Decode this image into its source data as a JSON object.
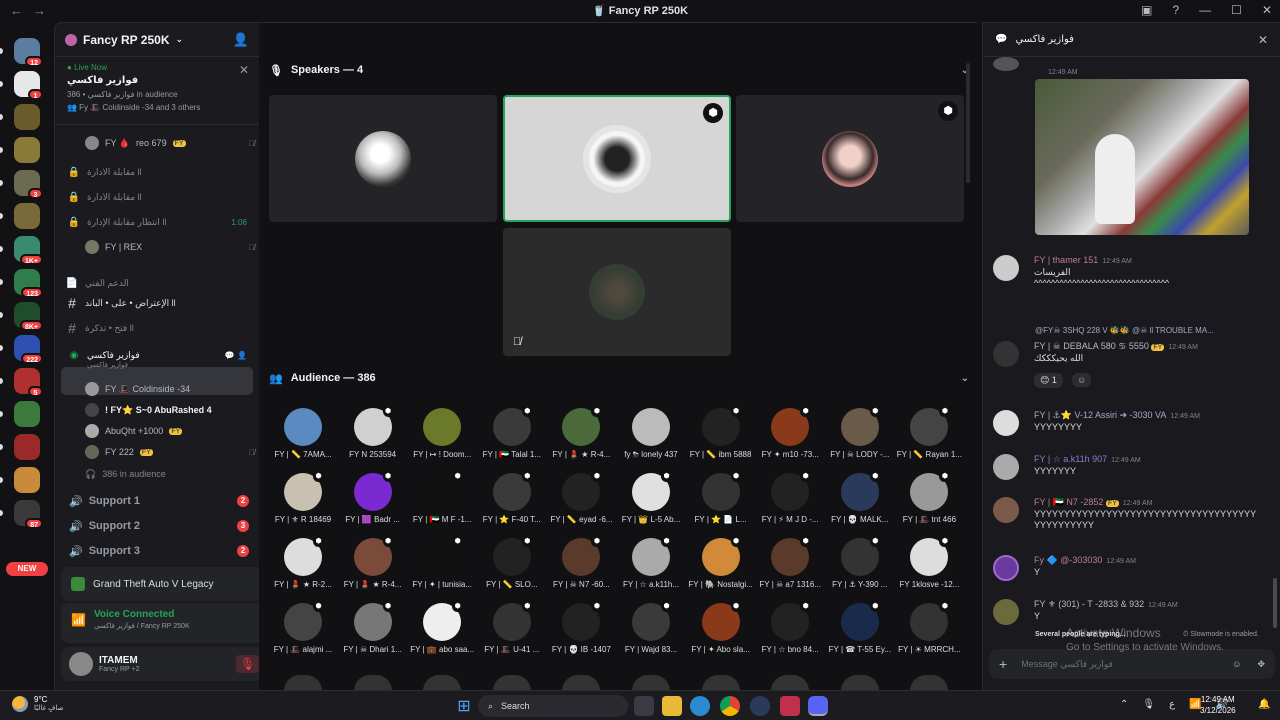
{
  "window": {
    "title": "Fancy RP 250K",
    "back": "←",
    "forward": "→"
  },
  "rail": {
    "servers": [
      {
        "badge": "12",
        "color": "#5a7da0"
      },
      {
        "badge": "1",
        "color": "#e7e7e7"
      },
      {
        "badge": "",
        "color": "#6b5a2a"
      },
      {
        "badge": "",
        "color": "#8a7a3a"
      },
      {
        "badge": "3",
        "color": "#6a6a50"
      },
      {
        "badge": "",
        "color": "#7a6a3a"
      },
      {
        "badge": "1K+",
        "color": "#3a8a70"
      },
      {
        "badge": "123",
        "color": "#2e7d4a"
      },
      {
        "badge": "8K+",
        "color": "#1f4d2a"
      },
      {
        "badge": "222",
        "color": "#2d4fb0"
      },
      {
        "badge": "5",
        "color": "#b03030"
      },
      {
        "badge": "",
        "color": "#3b7a3a"
      },
      {
        "badge": "",
        "color": "#9a2a2a"
      },
      {
        "badge": "",
        "color": "#c98a3a"
      },
      {
        "badge": "87",
        "color": "#3a3a3a"
      }
    ],
    "new_label": "NEW"
  },
  "guild": {
    "name": "Fancy RP 250K"
  },
  "live": {
    "tag": "Live Now",
    "title": "فوازير فاكسي",
    "audience": "فوازير فاكسي • 386 in audience",
    "speakers": "Coldinside -34 and 3 others"
  },
  "channels": {
    "top_user": {
      "name": "reo 679",
      "tag": "FY"
    },
    "items": [
      {
        "icon": "🔒",
        "label": "مقابلة الادارة ll"
      },
      {
        "icon": "🔒",
        "label": "مقابلة الادارة ll"
      },
      {
        "icon": "🔒",
        "label": "انتظار مقابلة الإدارة ll",
        "trail": "1:06"
      }
    ],
    "rex": "FY | REX",
    "category": "الدعم الفني",
    "text_channels": [
      {
        "label": "الإعتراض • على • الباند ll"
      },
      {
        "label": "فتح • تذكرة ll"
      }
    ],
    "stage": {
      "label": "فوازير فاكسي",
      "sub": "فوازير فاكسي"
    },
    "stage_users": [
      {
        "name": "FY 🎩 Coldinside -34"
      },
      {
        "name": "! FY⭐ S~0 AbuRashed 4"
      },
      {
        "name": "AbuQht +1000",
        "tag": "FY"
      },
      {
        "name": "FY 222",
        "tag": "FY"
      }
    ],
    "audience_count": "386 in audience",
    "supports": [
      {
        "label": "Support 1",
        "count": "2"
      },
      {
        "label": "Support 2",
        "count": "3"
      },
      {
        "label": "Support 3",
        "count": "2"
      }
    ]
  },
  "activity": {
    "game": "Grand Theft Auto V Legacy"
  },
  "voice": {
    "status": "Voice Connected",
    "where": "فوازير فاكسي / Fancy RP 250K"
  },
  "user": {
    "name": "ITAMEM",
    "status": "Fancy RP +2"
  },
  "main": {
    "speakers_title": "Speakers — 4",
    "audience_title": "Audience — 386",
    "audience": [
      {
        "label": "FY | 📏 7AMA...",
        "c": "#5a8ac0"
      },
      {
        "label": "FY N 253594",
        "c": "#d0d0d0"
      },
      {
        "label": "FY | ↦ ! Doom...",
        "c": "#6a7a2a"
      },
      {
        "label": "FY | 🇦🇪 Talal 1...",
        "c": "#3a3a3a"
      },
      {
        "label": "FY | 💄 ★ R-4...",
        "c": "#4a6a3a"
      },
      {
        "label": "fy ⛈ lonely 437",
        "c": "#bbbbbb"
      },
      {
        "label": "FY | 📏 ibm 5888",
        "c": "#222"
      },
      {
        "label": "FY ✦ m10 -73...",
        "c": "#8a3a1a"
      },
      {
        "label": "FY | ☠ LODY -...",
        "c": "#6a5a4a"
      },
      {
        "label": "FY | 📏 Rayan 1...",
        "c": "#444"
      },
      {
        "label": "FY | ⚜ R 18469",
        "c": "#c8c0b0"
      },
      {
        "label": "FY | 🟪 Badr ...",
        "c": "#7a2ad0"
      },
      {
        "label": "FY | 🇦🇪 M F -1...",
        "c": "#111"
      },
      {
        "label": "FY | ⭐ F-40 T...",
        "c": "#3a3a3a"
      },
      {
        "label": "FY | 📏 eyad -6...",
        "c": "#222"
      },
      {
        "label": "FY | 👑 L-5 Ab...",
        "c": "#e0e0e0"
      },
      {
        "label": "FY | ⭐ 📄 L...",
        "c": "#333"
      },
      {
        "label": "FY | ⚡ M J D -...",
        "c": "#222"
      },
      {
        "label": "FY | 💀 MALK...",
        "c": "#2a3a5a"
      },
      {
        "label": "FY | 🎩 tnt 466",
        "c": "#999"
      },
      {
        "label": "FY | 💄 ★ R-2...",
        "c": "#ddd"
      },
      {
        "label": "FY | 💄 ★ R-4...",
        "c": "#7a4a3a"
      },
      {
        "label": "FY | ✦ | tunisia...",
        "c": "#111"
      },
      {
        "label": "FY | 📏 SLO...",
        "c": "#222"
      },
      {
        "label": "FY | ☠ N7 -60...",
        "c": "#5a3a2a"
      },
      {
        "label": "FY | ☆ a.k11h...",
        "c": "#aaa"
      },
      {
        "label": "FY | 🐘 Nostalgi...",
        "c": "#d08a3a"
      },
      {
        "label": "FY | ☠ a7 1316...",
        "c": "#5a3a2a"
      },
      {
        "label": "FY | ⚓ Y-390 ...",
        "c": "#333"
      },
      {
        "label": "FY 1klosve -12...",
        "c": "#ddd"
      },
      {
        "label": "FY | 🎩 alajmi ...",
        "c": "#444"
      },
      {
        "label": "FY | ☠ Dhari 1...",
        "c": "#777"
      },
      {
        "label": "FY | 💼 abo saa...",
        "c": "#eee"
      },
      {
        "label": "FY | 🎩 U-41 ...",
        "c": "#333"
      },
      {
        "label": "FY | 💀 IB -1407",
        "c": "#222"
      },
      {
        "label": "FY | Wajd 83...",
        "c": "#3a3a3a"
      },
      {
        "label": "FY | ✦ Abo sla...",
        "c": "#8a3a1a"
      },
      {
        "label": "FY | ☆ bno 84...",
        "c": "#222"
      },
      {
        "label": "FY | ☎ T-55 Ey...",
        "c": "#1a2a4a"
      },
      {
        "label": "FY | ☀ MRRCH...",
        "c": "#333"
      }
    ]
  },
  "chat": {
    "title": "فوازير فاكسي",
    "msgs": [
      {
        "name": "FY | thamer 151",
        "time": "12:49 AM",
        "text": "الفريسات",
        "text2": "^^^^^^^^^^^^^^^^^^^^^^^^^^^^^^^^"
      },
      {
        "name": "FY | ☠ DEBALA 580 ♋ 5550",
        "tag": "FY",
        "time": "12:49 AM",
        "text": "الله يحيكككك",
        "reacts": "1"
      },
      {
        "name": "FY | ⚓⭐ V-12 Assiri ➜ -3030 VA",
        "time": "12:49 AM",
        "text": "YYYYYYYY"
      },
      {
        "name": "FY | ☆ a.k11h 907",
        "time": "12:49 AM",
        "text": "YYYYYYY"
      },
      {
        "name": "FY | 🇦🇪 N7 -2852",
        "tag": "FY",
        "time": "12:49 AM",
        "text": "YYYYYYYYYYYYYYYYYYYYYYYYYYYYYYYYYYYYYYYYYYYYYYY"
      },
      {
        "name": "Fy 🔷 @-303030",
        "time": "12:49 AM",
        "text": "Y"
      },
      {
        "name": "FY ⚜ (301) - T -2833 & 932",
        "time": "12:49 AM",
        "text": "Y"
      }
    ],
    "reply_header": "@FY☠ 3SHQ 228 V 🐝🐝 @☠ ll TROUBLE MA...",
    "typing": "Several people are typing...",
    "slowmode": "Slowmode is enabled.",
    "placeholder": "Message فوازير فاكسي"
  },
  "windows": {
    "activate": "Activate Windows",
    "activate_sub": "Go to Settings to activate Windows."
  },
  "taskbar": {
    "weather": "9°C",
    "weather_sub": "صافٍ غالبًا",
    "search": "Search",
    "time": "12:49 AM",
    "date": "3/12/2026",
    "lang": "ع"
  }
}
